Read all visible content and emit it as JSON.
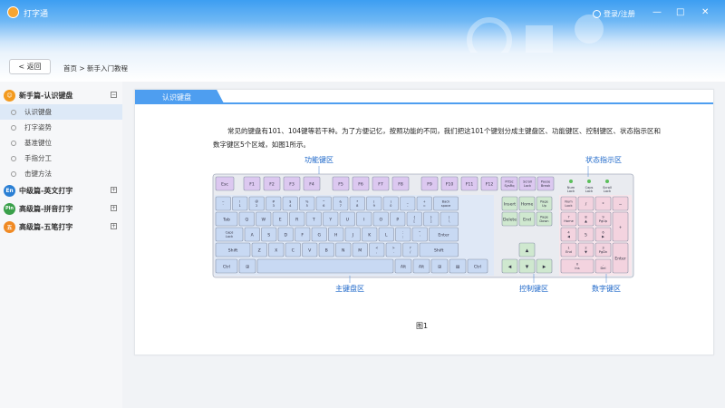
{
  "app": {
    "title": "打字通",
    "login": "登录/注册",
    "win_min": "—",
    "win_max": "□",
    "win_close": "✕"
  },
  "nav": {
    "back": "< 返回",
    "breadcrumb": "首页 > 新手入门教程"
  },
  "sidebar": {
    "cat1": {
      "icon": "😊",
      "label": "新手篇-认识键盘",
      "toggle": "−",
      "items": [
        "认识键盘",
        "打字姿势",
        "基准键位",
        "手指分工",
        "击键方法"
      ]
    },
    "cat2": {
      "icon": "En",
      "label": "中级篇-英文打字",
      "toggle": "+"
    },
    "cat3": {
      "icon": "Pin",
      "label": "高级篇-拼音打字",
      "toggle": "+"
    },
    "cat4": {
      "icon": "五",
      "label": "高级篇-五笔打字",
      "toggle": "+"
    }
  },
  "main": {
    "tab": "认识键盘",
    "paragraph": "常见的键盘有101、104键等若干种。为了方便记忆，按照功能的不同，我们把这101个键划分成主键盘区、功能键区、控制键区、状态指示区和数字键区5个区域，如图1所示。",
    "caption": "图1",
    "labels": {
      "function": "功能键区",
      "status": "状态指示区",
      "main": "主键盘区",
      "control": "控制键区",
      "numpad": "数字键区"
    }
  },
  "keyboard": {
    "fn_row": [
      "Esc",
      "F1",
      "F2",
      "F3",
      "F4",
      "F5",
      "F6",
      "F7",
      "F8",
      "F9",
      "F10",
      "F11",
      "F12"
    ],
    "sys_keys": [
      "PrtSc SysRq",
      "Scroll Lock",
      "Pause Break"
    ],
    "status_leds": [
      "Num Lock",
      "Caps Lock",
      "Scroll Lock"
    ],
    "row1": [
      "~ `",
      "! 1",
      "@ 2",
      "# 3",
      "$ 4",
      "% 5",
      "^ 6",
      "& 7",
      "* 8",
      "( 9",
      ") 0",
      "_ -",
      "+ =",
      "Back space"
    ],
    "row2": [
      "Tab",
      "Q",
      "W",
      "E",
      "R",
      "T",
      "Y",
      "U",
      "I",
      "O",
      "P",
      "{ [",
      "} ]",
      "| \\"
    ],
    "row3": [
      "Caps Lock",
      "A",
      "S",
      "D",
      "F",
      "G",
      "H",
      "J",
      "K",
      "L",
      ": ;",
      "\" '",
      "Enter"
    ],
    "row4": [
      "Shift",
      "Z",
      "X",
      "C",
      "V",
      "B",
      "N",
      "M",
      "< ,",
      "> .",
      "? /",
      "Shift"
    ],
    "row5": [
      "Ctrl",
      "⊞",
      "",
      "Alt",
      "Alt",
      "⊞",
      "▤",
      "Ctrl"
    ],
    "ctrl_top": [
      "Insert",
      "Home",
      "Page Up",
      "Delete",
      "End",
      "Page Down"
    ],
    "arrows": [
      "▲",
      "◀",
      "▼",
      "▶"
    ],
    "numpad": [
      "Num Lock",
      "/",
      "*",
      "−",
      "7 Home",
      "8 ▲",
      "9 PgUp",
      "+",
      "4 ◀",
      "5",
      "6 ▶",
      "1 End",
      "2 ▼",
      "3 PgDn",
      "Enter",
      "0 Ins",
      ". Del"
    ]
  },
  "colors": {
    "accent": "#4e9ef0",
    "fn_key": "#dcc8f0",
    "main_key": "#c8d9f3",
    "ctrl_key": "#cfe8cf",
    "num_key": "#f3d3df",
    "label": "#1d67c9"
  }
}
